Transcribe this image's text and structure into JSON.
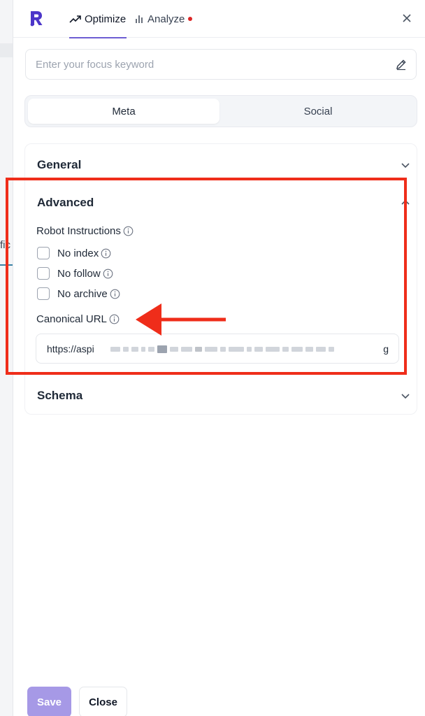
{
  "background": {
    "fragment_text": "fic"
  },
  "header": {
    "tabs": [
      {
        "label": "Optimize",
        "icon": "trending-up-icon",
        "active": true
      },
      {
        "label": "Analyze",
        "icon": "bar-chart-icon",
        "active": false,
        "has_alert_dot": true
      }
    ],
    "close_icon": "close-icon",
    "logo_icon": "r-logo-icon"
  },
  "focus_keyword": {
    "value": "",
    "placeholder": "Enter your focus keyword",
    "icon": "pencil-icon"
  },
  "segment": {
    "options": [
      "Meta",
      "Social"
    ],
    "selected": "Meta"
  },
  "accordion": {
    "general": {
      "title": "General",
      "expanded": false
    },
    "advanced": {
      "title": "Advanced",
      "expanded": true,
      "robot_label": "Robot Instructions",
      "options": [
        {
          "label": "No index",
          "checked": false
        },
        {
          "label": "No follow",
          "checked": false
        },
        {
          "label": "No archive",
          "checked": false
        }
      ],
      "canonical_label": "Canonical URL",
      "canonical_url_start": "https://aspi",
      "canonical_url_end": "g"
    },
    "schema": {
      "title": "Schema",
      "expanded": false
    }
  },
  "footer": {
    "save_label": "Save",
    "close_label": "Close"
  },
  "colors": {
    "accent": "#6d5dd3",
    "save_button": "#a699e6",
    "annotation": "#ef2d1a",
    "alert_dot": "#dc2626"
  }
}
